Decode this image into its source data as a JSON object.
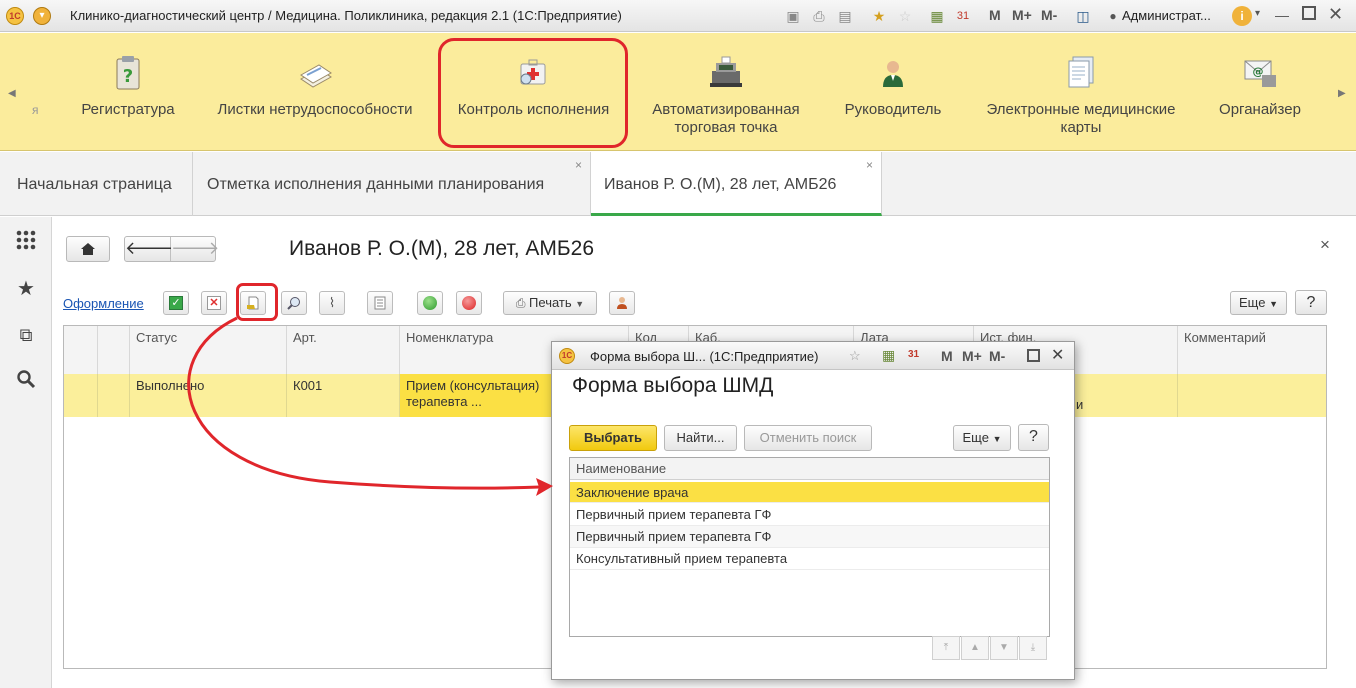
{
  "window": {
    "title": "Клинико-диагностический центр / Медицина. Поликлиника, редакция 2.1  (1С:Предприятие)",
    "logo": "1С",
    "user": "Администрат...",
    "mem_labels": [
      "M",
      "M+",
      "M-"
    ]
  },
  "sections": {
    "partial_left": "я",
    "items": [
      {
        "label": "Регистратура",
        "icon": "clipboard-question-icon"
      },
      {
        "label": "Листки нетрудоспособности",
        "icon": "papers-stack-icon"
      },
      {
        "label": "Контроль исполнения",
        "icon": "medkit-magnifier-icon"
      },
      {
        "label": "Автоматизированная торговая точка",
        "icon": "cash-register-icon"
      },
      {
        "label": "Руководитель",
        "icon": "manager-person-icon"
      },
      {
        "label": "Электронные медицинские карты",
        "icon": "documents-icon"
      },
      {
        "label": "Органайзер",
        "icon": "email-organizer-icon"
      }
    ]
  },
  "tabs": [
    {
      "label": "Начальная страница",
      "closable": false
    },
    {
      "label": "Отметка исполнения данными планирования",
      "closable": true
    },
    {
      "label": "Иванов Р. О.(М), 28 лет, АМБ26",
      "closable": true,
      "active": true
    }
  ],
  "form": {
    "title": "Иванов Р. О.(М), 28 лет, АМБ26",
    "oformlenie": "Оформление",
    "print_label": "Печать",
    "more_label": "Еще",
    "help_label": "?",
    "close_glyph": "×"
  },
  "grid": {
    "headers": [
      "Статус",
      "Арт.",
      "Номенклатура",
      "Код",
      "Каб.",
      "Дата",
      "Ист. фин.",
      "Комментарий"
    ],
    "rows": [
      {
        "status": "Выполнено",
        "art": "К001",
        "nomenclature": "Прием (консультация) терапевта ...",
        "cell_partial": "и"
      }
    ]
  },
  "popup": {
    "window_title": "Форма выбора Ш... (1С:Предприятие)",
    "title": "Форма выбора ШМД",
    "mem_labels": [
      "M",
      "M+",
      "M-"
    ],
    "buttons": {
      "select": "Выбрать",
      "find": "Найти...",
      "cancel_search": "Отменить поиск",
      "more": "Еще",
      "help": "?"
    },
    "column_header": "Наименование",
    "items": [
      "Заключение врача",
      "Первичный прием терапевта ГФ",
      "Первичный прием терапевта ГФ",
      "Консультативный прием терапевта"
    ],
    "selected_index": 0
  },
  "colors": {
    "sections_bg": "#fbec9c",
    "highlight_row": "#fbe044",
    "active_tab_underline": "#3aa849",
    "annotation_red": "#e0262b"
  }
}
